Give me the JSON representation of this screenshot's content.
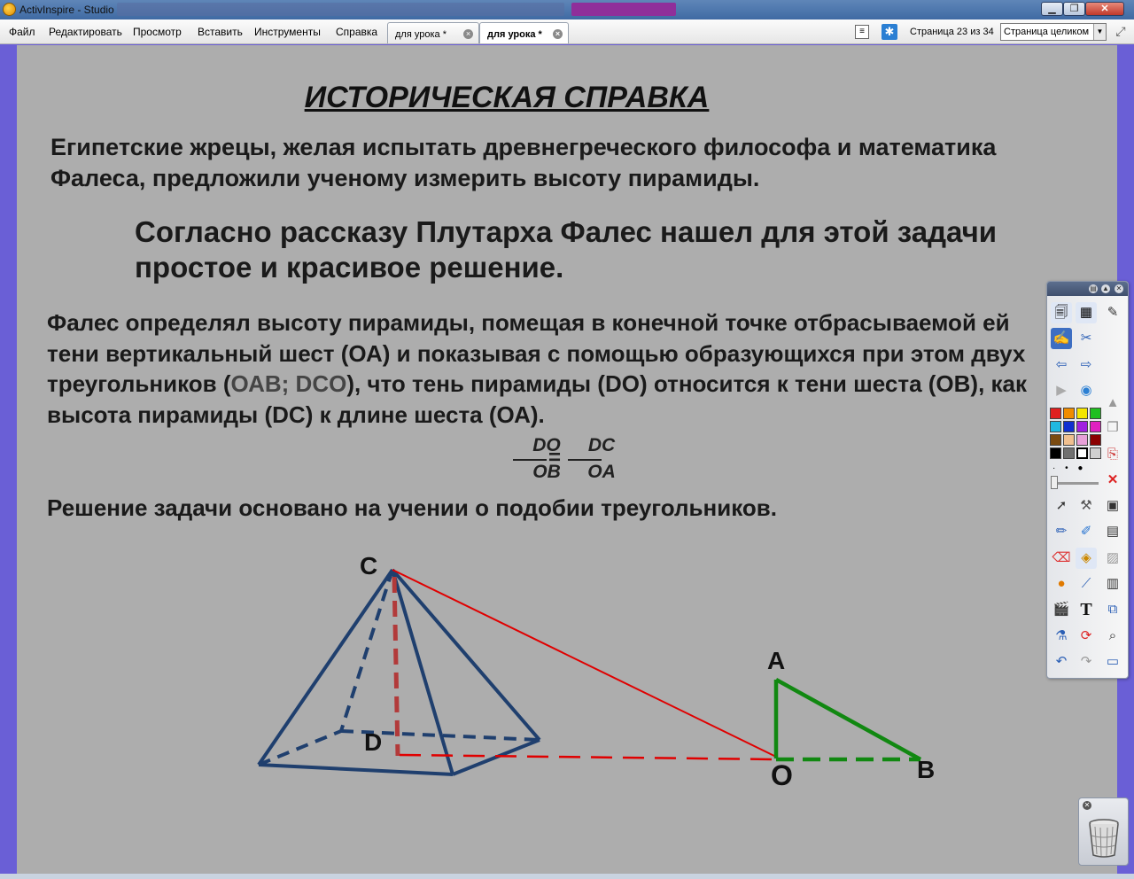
{
  "window": {
    "title": "ActivInspire - Studio",
    "controls": {
      "minimize": "▁",
      "maximize": "❐",
      "close": "✕"
    }
  },
  "menu": {
    "items": [
      "Файл",
      "Редактировать",
      "Просмотр",
      "Вставить",
      "Инструменты",
      "Справка"
    ]
  },
  "tabs": [
    {
      "label": "для урока *",
      "active": false
    },
    {
      "label": "для урока *",
      "active": true
    }
  ],
  "pager": {
    "page_indicator": "Страница 23 из 34",
    "zoom_value": "Страница целиком"
  },
  "slide": {
    "heading": "ИСТОРИЧЕСКАЯ СПРАВКА",
    "para1": "Египетские жрецы, желая испытать древнегреческого философа и математика Фалеса, предложили ученому измерить высоту пирамиды.",
    "para2": "Согласно рассказу Плутарха Фалес нашел для этой задачи простое и красивое решение.",
    "para3": {
      "part1": "Фалес определял высоту пирамиды, помещая в конечной точке отбрасываемой ей тени вертикальный шест (ОА) и показывая с помощью образующихся при этом двух треугольников (",
      "highlight": "ОАВ; DCO",
      "part2": "), что тень пирамиды (DO) относится к тени шеста (ОВ), как высота пирамиды (DC) к длине шеста (ОА)."
    },
    "formula": {
      "left_num": "DO",
      "left_den": "OB",
      "equals": "=",
      "right_num": "DC",
      "right_den": "OA"
    },
    "para4": "Решение задачи основано на учении о подобии треугольников.",
    "labels": {
      "C": "C",
      "D": "D",
      "A": "A",
      "O": "O",
      "B": "B"
    }
  },
  "colors": {
    "canvas": "#adadad",
    "pyramid": "#1f3f6e",
    "height_line": "#b23a3a",
    "ray": "#e00000",
    "pole_triangle": "#118811"
  },
  "toolbox": {
    "icons": [
      "page-browser-icon",
      "resource-browser-icon",
      "object-browser-icon",
      "notes-browser-icon",
      "previous-page-icon",
      "next-page-icon",
      "play-icon",
      "globe-icon",
      "select-icon",
      "tools-icon",
      "pen-icon",
      "highlighter-icon",
      "eraser-icon",
      "fill-icon",
      "shape-icon",
      "connector-icon",
      "clip-icon",
      "text-icon",
      "spray-icon",
      "refresh-icon",
      "undo-icon",
      "redo-icon"
    ],
    "swatches": [
      "#e02020",
      "#f08c00",
      "#f5e600",
      "#20c020",
      "#20b8e0",
      "#1030d0",
      "#a020e0",
      "#e020c0",
      "#7a4a10",
      "#f0c090",
      "#e8a0d8",
      "#8b0000",
      "#000000",
      "#707070",
      "#ffffff",
      "#d0d0d0"
    ]
  }
}
